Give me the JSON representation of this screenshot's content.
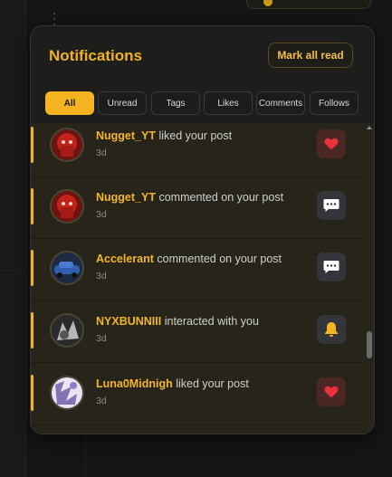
{
  "panel": {
    "title": "Notifications",
    "mark_all_read": "Mark all read"
  },
  "tabs": [
    {
      "label": "All",
      "active": true
    },
    {
      "label": "Unread",
      "active": false
    },
    {
      "label": "Tags",
      "active": false
    },
    {
      "label": "Likes",
      "active": false
    },
    {
      "label": "Comments",
      "active": false
    },
    {
      "label": "Follows",
      "active": false
    }
  ],
  "notifications": [
    {
      "user": "Nugget_YT",
      "action": "liked your post",
      "time": "3d",
      "icon": "heart-icon",
      "avatar_color": "#b3201a"
    },
    {
      "user": "Nugget_YT",
      "action": "commented on your post",
      "time": "3d",
      "icon": "comment-icon",
      "avatar_color": "#b3201a"
    },
    {
      "user": "Accelerant",
      "action": "commented on your post",
      "time": "3d",
      "icon": "comment-icon",
      "avatar_color": "#2b4e86"
    },
    {
      "user": "NYXBUNNIII",
      "action": "interacted with you",
      "time": "3d",
      "icon": "bell-icon",
      "avatar_color": "#3a3a3a"
    },
    {
      "user": "Luna0Midnigh",
      "action": "liked your post",
      "time": "3d",
      "icon": "heart-icon",
      "avatar_color": "#8a7ab8"
    }
  ],
  "colors": {
    "accent": "#f4b321",
    "heart": "#e8323c",
    "bell": "#f4b321",
    "panel_bg": "#1d1d1c",
    "list_bg": "#272519"
  }
}
